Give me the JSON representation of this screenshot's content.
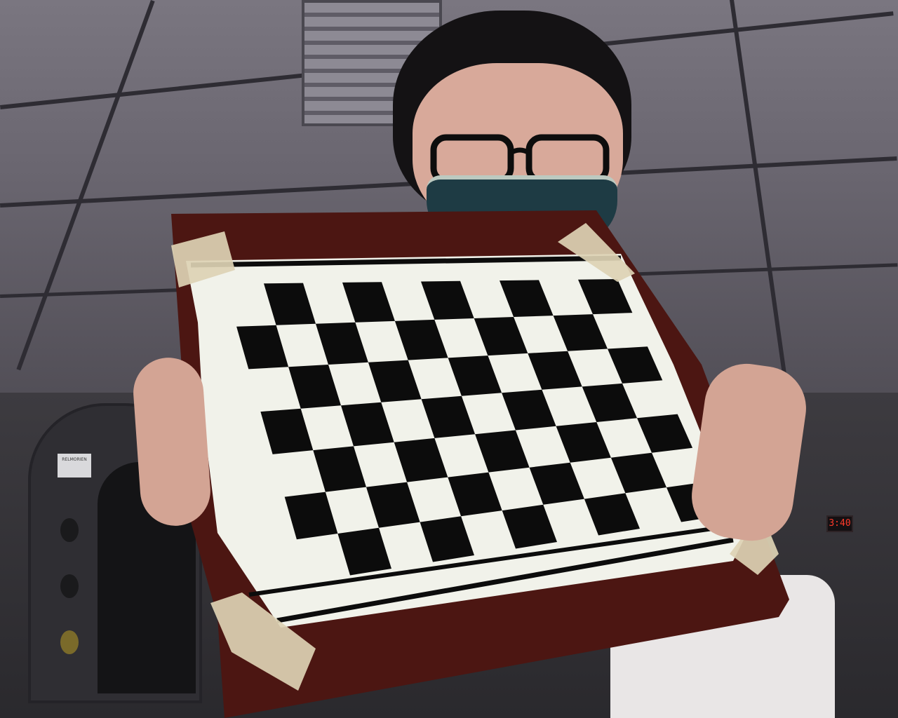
{
  "scene": {
    "description_free": true,
    "photo_kind": "camera snapshot",
    "kiosk_label_text": "RELMORIEN",
    "clock_text": "3:40"
  },
  "checkerboard": {
    "rows": 7,
    "cols": 10,
    "square_color": "#0c0c0c",
    "paper_color": "#f1f2ea",
    "board_color": "#4c1612",
    "tape_color": "#ddd2b4"
  },
  "colors": {
    "ceiling": "#6a6670",
    "skin": "#d8a99a",
    "mask": "#1e3b44",
    "hair": "#141214"
  }
}
